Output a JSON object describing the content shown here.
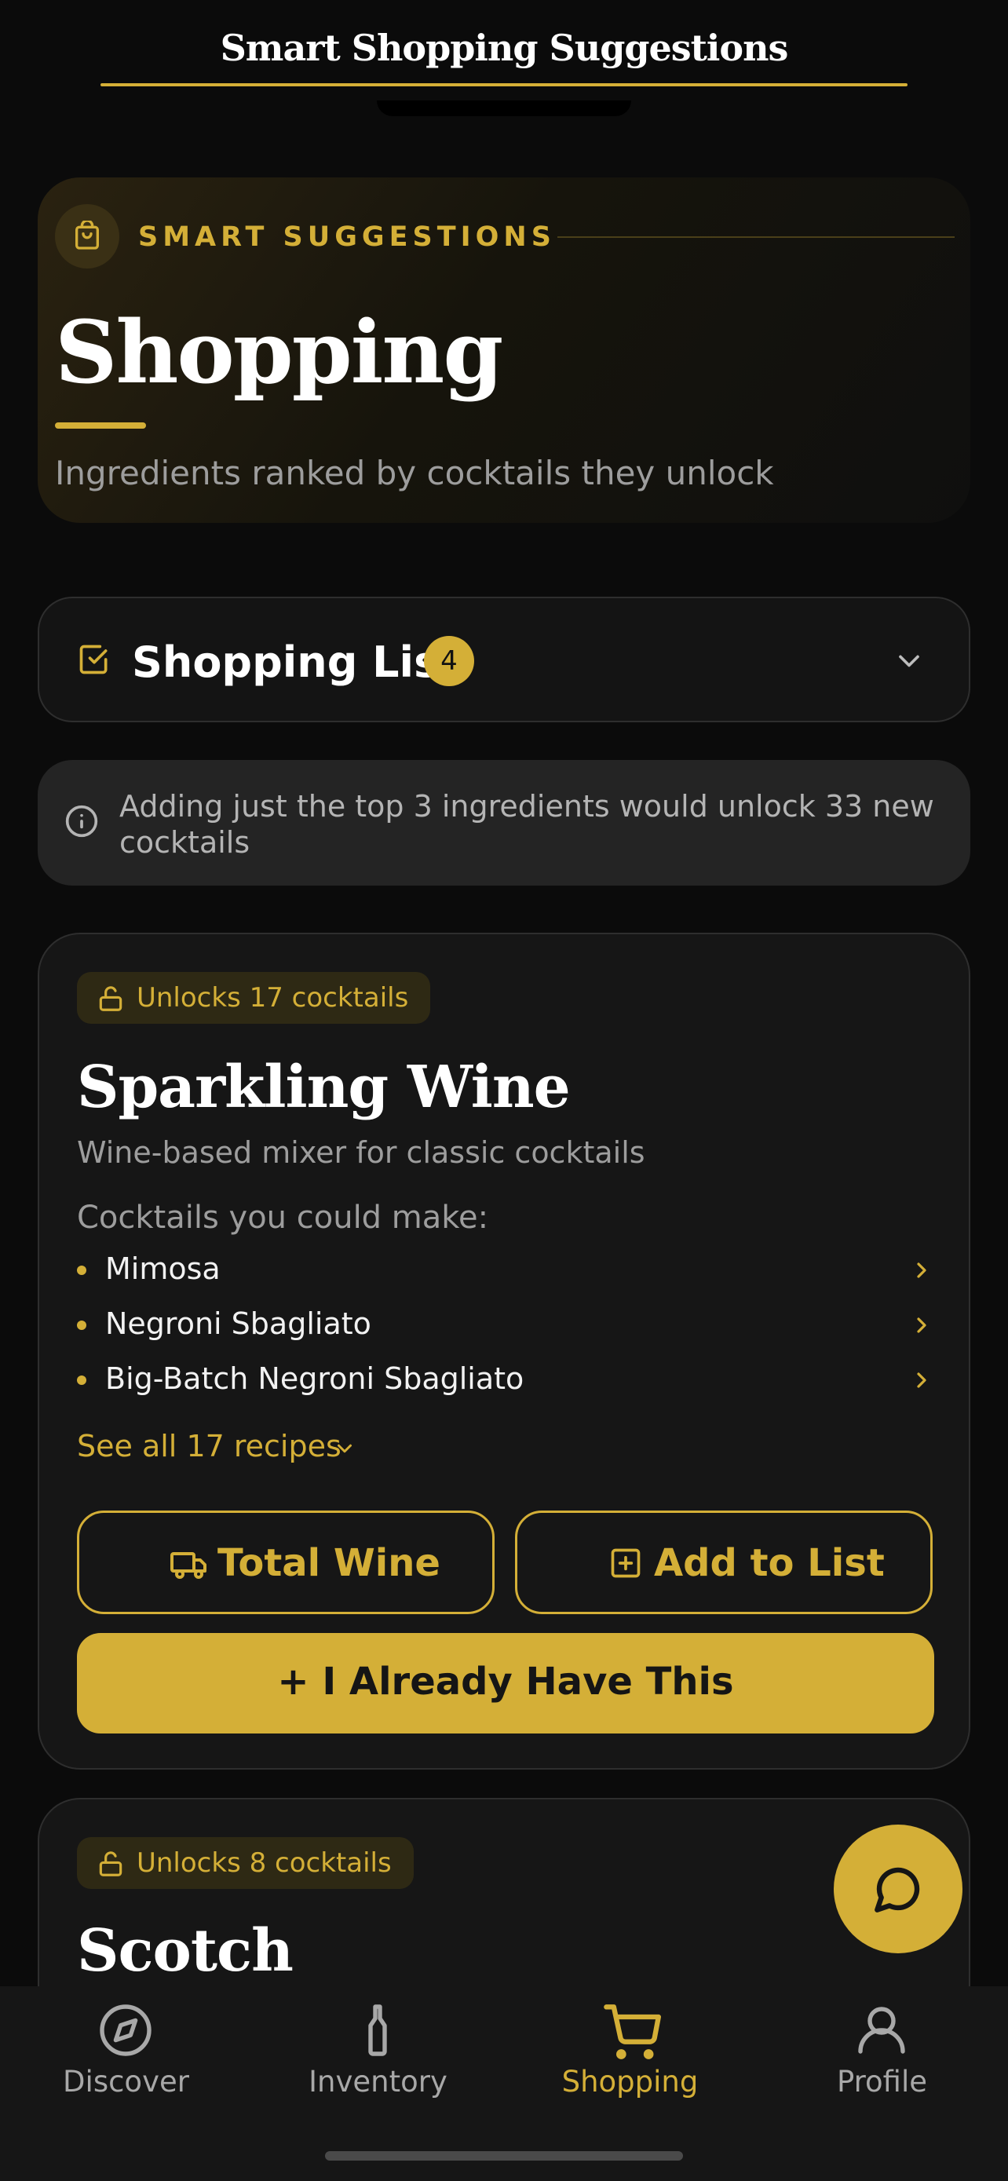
{
  "header": {
    "title": "Smart Shopping Suggestions"
  },
  "hero": {
    "icon": "shopping-bag-icon",
    "kicker": "SMART SUGGESTIONS",
    "title": "Shopping",
    "subtitle": "Ingredients ranked by cocktails they unlock"
  },
  "shopping_list": {
    "title": "Shopping List",
    "count": "4",
    "icon": "check-square-icon"
  },
  "info_banner": {
    "text": "Adding just the top 3 ingredients would unlock 33 new cocktails"
  },
  "cards": [
    {
      "badge": "Unlocks 17 cocktails",
      "title": "Sparkling Wine",
      "description": "Wine-based mixer for classic cocktails",
      "could_make_label": "Cocktails you could make:",
      "cocktails": [
        "Mimosa",
        "Negroni Sbagliato",
        "Big-Batch Negroni Sbagliato"
      ],
      "see_all": "See all 17 recipes",
      "store_button": "Total Wine",
      "add_button": "Add to List",
      "have_button": "+ I Already Have This"
    },
    {
      "badge": "Unlocks 8 cocktails",
      "title": "Scotch"
    }
  ],
  "tabs": [
    {
      "label": "Discover",
      "icon": "compass-icon",
      "active": false
    },
    {
      "label": "Inventory",
      "icon": "bottle-icon",
      "active": false
    },
    {
      "label": "Shopping",
      "icon": "cart-icon",
      "active": true
    },
    {
      "label": "Profile",
      "icon": "user-icon",
      "active": false
    }
  ],
  "colors": {
    "accent": "#d4af37",
    "background": "#0b0b0b",
    "card": "#161616"
  }
}
